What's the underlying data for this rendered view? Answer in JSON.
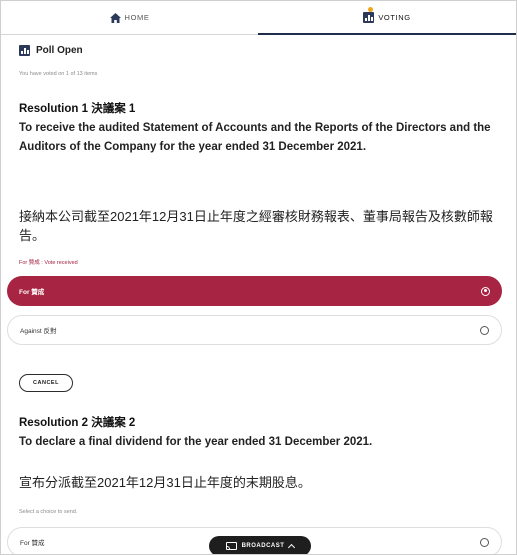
{
  "tabs": {
    "home_label": "HOME",
    "home_icon": "home-icon",
    "voting_label": "VOTING",
    "voting_icon": "bar-chart-icon",
    "voting_badge_color": "#f2a51a"
  },
  "poll": {
    "status": "Poll Open",
    "voted_count": "You have voted on 1 of 13 items"
  },
  "resolutions": [
    {
      "heading": "Resolution 1 決議案 1",
      "text_en": "To receive the audited Statement of Accounts and the Reports of the Directors and the Auditors of the Company for the year ended 31 December 2021.",
      "text_zh": "接納本公司截至2021年12月31日止年度之經審核財務報表、董事局報告及核數師報告。",
      "status_note": "For 贊成 : Vote received",
      "choices": [
        {
          "label": "For 贊成",
          "selected": true
        },
        {
          "label": "Against 反對",
          "selected": false
        }
      ],
      "cancel_label": "CANCEL"
    },
    {
      "heading": "Resolution 2 決議案 2",
      "text_en": "To declare a final dividend for the year ended 31 December 2021.",
      "text_zh": "宣布分派截至2021年12月31日止年度的末期股息。",
      "status_note": "Select a choice to send.",
      "choices": [
        {
          "label": "For 贊成",
          "selected": false
        }
      ]
    }
  ],
  "broadcast": {
    "label": "BROADCAST",
    "icon": "cast-icon"
  },
  "colors": {
    "accent": "#a72542",
    "navy": "#2c3a5a"
  }
}
